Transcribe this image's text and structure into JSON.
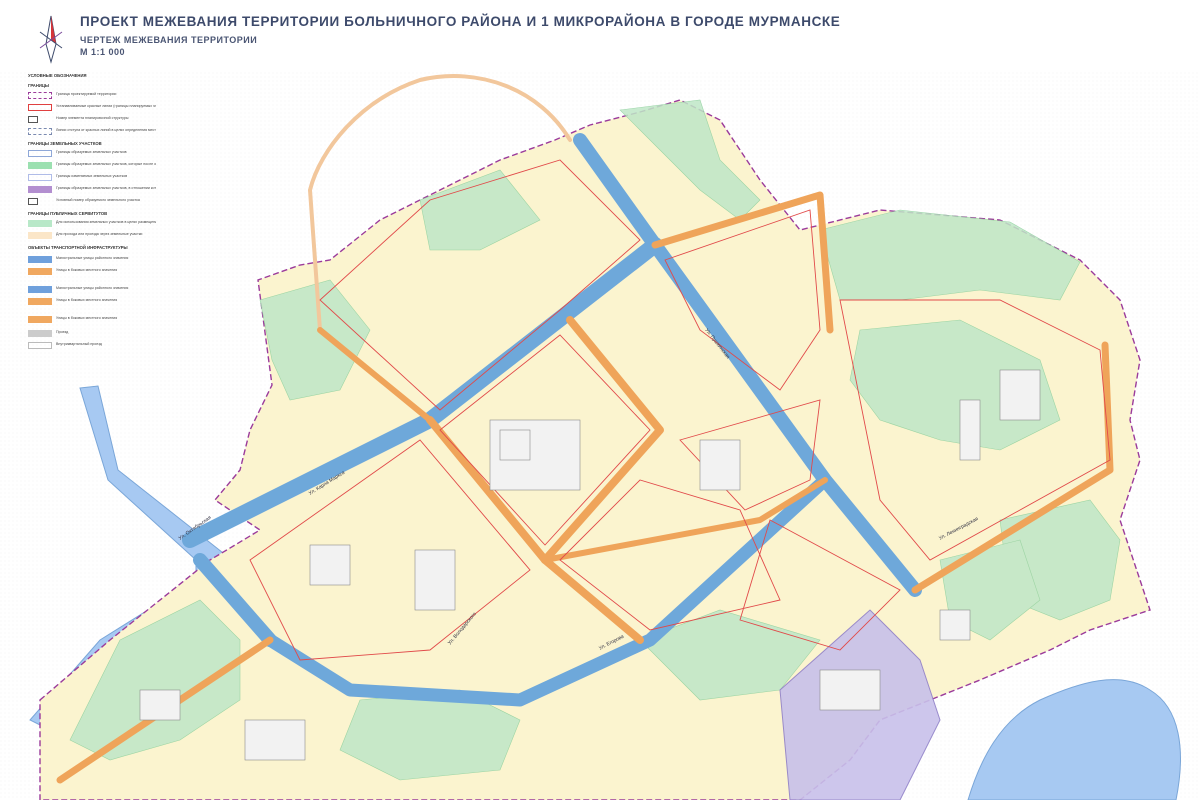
{
  "header": {
    "title": "ПРОЕКТ МЕЖЕВАНИЯ ТЕРРИТОРИИ БОЛЬНИЧНОГО РАЙОНА И 1 МИКРОРАЙОНА В ГОРОДЕ МУРМАНСКЕ",
    "subtitle": "ЧЕРТЕЖ МЕЖЕВАНИЯ ТЕРРИТОРИИ",
    "scale": "М 1:1 000"
  },
  "legend": {
    "title": "УСЛОВНЫЕ ОБОЗНАЧЕНИЯ",
    "sections": [
      {
        "heading": "ГРАНИЦЫ",
        "items": [
          {
            "label": "Граница проектируемой территории",
            "color": "#9b3b9b",
            "style": "dash"
          },
          {
            "label": "Устанавливаемые красные линии (границы планируемых элементов планировочной структуры)",
            "color": "#e04040",
            "style": "line"
          },
          {
            "label": "Номер элемента планировочной структуры",
            "color": "#555555",
            "style": "box"
          },
          {
            "label": "Линии отступа от красных линий в целях определения мест допустимого размещения зданий, строений, сооружений",
            "color": "#7a8ab0",
            "style": "dash"
          }
        ]
      },
      {
        "heading": "ГРАНИЦЫ ЗЕМЕЛЬНЫХ УЧАСТКОВ",
        "items": [
          {
            "label": "Границы образуемых земельных участков",
            "color": "#8fa8d8",
            "style": "box"
          },
          {
            "label": "Границы образуемых земельных участков, которые после образования будут относиться к территориям общего пользования",
            "color": "#9be0b0",
            "style": "fill"
          },
          {
            "label": "Границы изменяемых земельных участков",
            "color": "#b0bce8",
            "style": "box"
          },
          {
            "label": "Границы образуемых земельных участков, в отношении которых предполагается их резервирование и (или) изъятие для государственных или муниципальных нужд",
            "color": "#b38fd0",
            "style": "fill"
          },
          {
            "label": "Условный номер образуемого земельного участка",
            "color": "#555555",
            "style": "box"
          }
        ]
      },
      {
        "heading": "ГРАНИЦЫ ПУБЛИЧНЫХ СЕРВИТУТОВ",
        "items": [
          {
            "label": "Для использования земельных участков в целях размещения сетей инженерно-технического обеспечения",
            "color": "#b8e8c8",
            "style": "fill"
          },
          {
            "label": "Для прохода или проезда через земельные участки",
            "color": "#fbe6c8",
            "style": "fill"
          }
        ]
      },
      {
        "heading": "ОБЪЕКТЫ ТРАНСПОРТНОЙ ИНФРАСТРУКТУРЫ",
        "items": [
          {
            "label": "Магистральные улицы районного значения",
            "color": "#6fa0dc",
            "style": "fill"
          },
          {
            "label": "Улицы в боковых местного значения",
            "color": "#f0a860",
            "style": "fill"
          },
          {
            "label": "Магистральные улицы районного значения",
            "color": "#6fa0dc",
            "style": "fill"
          },
          {
            "label": "Улицы в боковых местного значения",
            "color": "#f0a860",
            "style": "fill"
          },
          {
            "label": "Улицы в боковых местного значения",
            "color": "#f0a860",
            "style": "fill"
          },
          {
            "label": "Проезд",
            "color": "#cccccc",
            "style": "fill"
          },
          {
            "label": "Внутриквартальный проезд",
            "color": "#dddddd",
            "style": "line"
          }
        ]
      }
    ]
  },
  "map_labels": [
    {
      "text": "Ул. Карла Маркса",
      "color": "#334"
    },
    {
      "text": "Ул. Пушкинская",
      "color": "#334"
    },
    {
      "text": "Ул. Володарского",
      "color": "#334"
    },
    {
      "text": "Ул. Октябрьская",
      "color": "#334"
    },
    {
      "text": "Ул. Егорова",
      "color": "#334"
    },
    {
      "text": "Ул. Ленинградская",
      "color": "#334"
    }
  ],
  "colors": {
    "block_fill": "#fbf4cf",
    "green_fill": "#bfe7c7",
    "main_road": "#6ea8da",
    "local_road": "#efa45a",
    "red_line": "#e14a4a",
    "boundary": "#9b3b9b",
    "water": "#a7c9f2",
    "reserve": "#c8c0ea"
  }
}
